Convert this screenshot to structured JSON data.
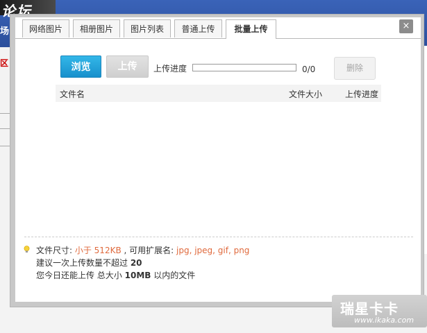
{
  "background": {
    "logo_text": "论坛",
    "nav_char": "场",
    "red_link": "区"
  },
  "dialog": {
    "tabs": [
      {
        "label": "网络图片"
      },
      {
        "label": "相册图片"
      },
      {
        "label": "图片列表"
      },
      {
        "label": "普通上传"
      },
      {
        "label": "批量上传"
      }
    ],
    "active_tab": "批量上传",
    "close_label": "×"
  },
  "upload": {
    "browse_label": "浏览",
    "upload_label": "上传",
    "progress_label": "上传进度",
    "progress_count": "0/0",
    "progress_fraction": 0,
    "delete_label": "删除"
  },
  "file_table": {
    "columns": [
      "文件名",
      "文件大小",
      "上传进度"
    ],
    "rows": []
  },
  "info": {
    "size_prefix": "文件尺寸: ",
    "size_value": "小于 512KB",
    "ext_prefix": " , 可用扩展名: ",
    "ext_value": "jpg, jpeg, gif, png",
    "line2_prefix": "建议一次上传数量不超过 ",
    "line2_value": "20",
    "line3_prefix": "您今日还能上传 总大小 ",
    "line3_value": "10MB",
    "line3_suffix": " 以内的文件"
  },
  "watermark": {
    "title": "瑞星卡卡",
    "url": "www.ikaka.com"
  },
  "colors": {
    "accent_blue": "#1890cc",
    "hint_orange": "#e06a3d",
    "header_blue": "#2c4f9c"
  }
}
